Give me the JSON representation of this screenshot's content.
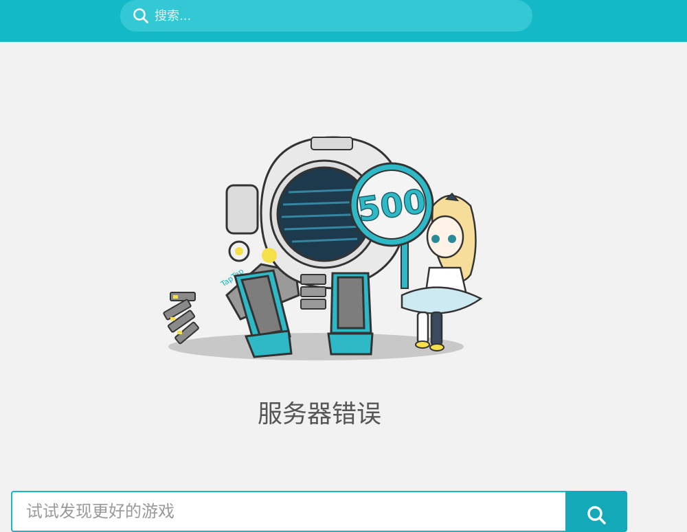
{
  "header": {
    "search_placeholder": "搜索..."
  },
  "illustration": {
    "sign_text": "500",
    "robot_arm_text": "TapTap"
  },
  "main": {
    "error_title": "服务器错误"
  },
  "bottom_search": {
    "placeholder": "试试发现更好的游戏"
  },
  "colors": {
    "header_bg": "#14b9c8",
    "header_search_bg": "#34c7d4",
    "accent": "#14a9b8",
    "page_bg": "#f2f2f2"
  },
  "icons": [
    "search-icon"
  ]
}
